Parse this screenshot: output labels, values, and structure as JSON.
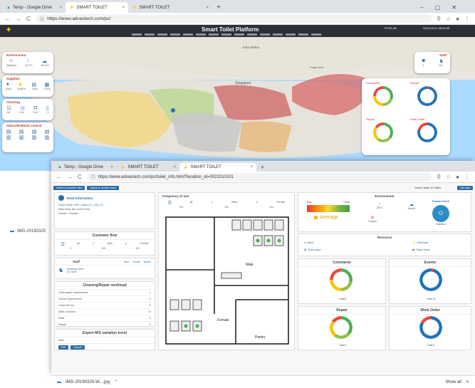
{
  "back_window": {
    "tabs": [
      {
        "title": "Temp - Google Drive"
      },
      {
        "title": "SMART TOILET"
      },
      {
        "title": "SMART TOILET"
      }
    ],
    "url": "https://www.advastech.com/pc/",
    "app_title": "Smart Toilet Platform",
    "header_right": "FFHE-1B",
    "time_text": "2019-03-21 08:00:35",
    "side_labels": [
      "Environment",
      "Supplies",
      "Cleaning",
      "Odour/Rubbish control"
    ],
    "env_values": [
      "Satisfied",
      "24.7°C",
      "83.9 %"
    ],
    "supply_values": [
      "Good",
      "8.52Kb",
      "1.6Lb",
      "0.3Lb"
    ],
    "clean_values": [
      "3/0",
      "0 hr",
      "0 Ltr",
      "0"
    ],
    "staff_label": "Staff",
    "staff_values": [
      "3",
      "0/0"
    ],
    "donut_titles": [
      "Comments",
      "Events",
      "Repair",
      "Work Order"
    ],
    "map_labels": [
      "Singapore",
      "Pulau Ubin",
      "Pulau Tekong",
      "Johor Bahru"
    ]
  },
  "front_window": {
    "tabs": [
      {
        "title": "Temp - Google Drive"
      },
      {
        "title": "SMART TOILET"
      },
      {
        "title": "SMART TOILET"
      }
    ],
    "url": "https://www.advastech.com/pc/toilet_info.html?location_id=0022010101",
    "top_buttons": [
      "Switch to another toilet",
      "Switch to another toilet"
    ],
    "switch_text": "Switch Male to Statis",
    "edit_btn": "Get data",
    "toilet_name": "Toilet Information",
    "toilet_info": [
      "Toilet: North JOB 1 West 07_JOB_C2",
      "Main Area: All rooms Floor",
      "Gender: Female"
    ],
    "customer_flow": {
      "title": "Customer flow",
      "cols": [
        "All",
        "Male",
        "Female"
      ],
      "values": [
        "0",
        "0/0",
        "0/0"
      ]
    },
    "staff": {
      "title": "Staff",
      "tabs": [
        "Mon",
        "Create",
        "Delete"
      ],
      "status": "Working Time",
      "sub": "No data"
    },
    "cleaning": {
      "title": "Cleaning/Repair workload",
      "rows": [
        {
          "label": "Toilet paper replacement",
          "value": "1"
        },
        {
          "label": "Tissue replacement",
          "value": "0"
        },
        {
          "label": "Clean the bin",
          "value": "0"
        },
        {
          "label": "Mark Cleaned",
          "value": "10"
        },
        {
          "label": "Staff",
          "value": "0"
        },
        {
          "label": "Repair",
          "value": "0"
        }
      ]
    },
    "export": {
      "title": "Export MIS variation trend",
      "field": "Date",
      "buttons": [
        "Edit",
        "Search"
      ]
    },
    "freq": {
      "title": "Frequency of use",
      "cols": [
        "All",
        "Male",
        "Female"
      ],
      "values": [
        "0%",
        "0%",
        "0%"
      ]
    },
    "floor": {
      "male": "Male",
      "female": "Female",
      "pantry": "Pantry"
    },
    "environment": {
      "title": "Environment",
      "bad": "Bad",
      "great": "Great",
      "status": "Average",
      "items": [
        "26°C",
        "Humid",
        "0.0ppm"
      ],
      "powder": "Powder Smell",
      "powder_status": "Satisfied"
    },
    "resource": {
      "title": "Resource",
      "items": [
        "Water",
        "Electricity",
        "Toilet paper",
        "Paper towel"
      ]
    },
    "donuts": [
      {
        "title": "Comments",
        "total": "Total:8"
      },
      {
        "title": "Events",
        "total": "Total:15"
      },
      {
        "title": "Repair",
        "total": "Total:8"
      },
      {
        "title": "Work Order",
        "total": "Total:8"
      }
    ]
  },
  "side_file": "IMG-20190325",
  "download": {
    "file": "IMG-20190325-W....jpg",
    "show_all": "Show all"
  }
}
